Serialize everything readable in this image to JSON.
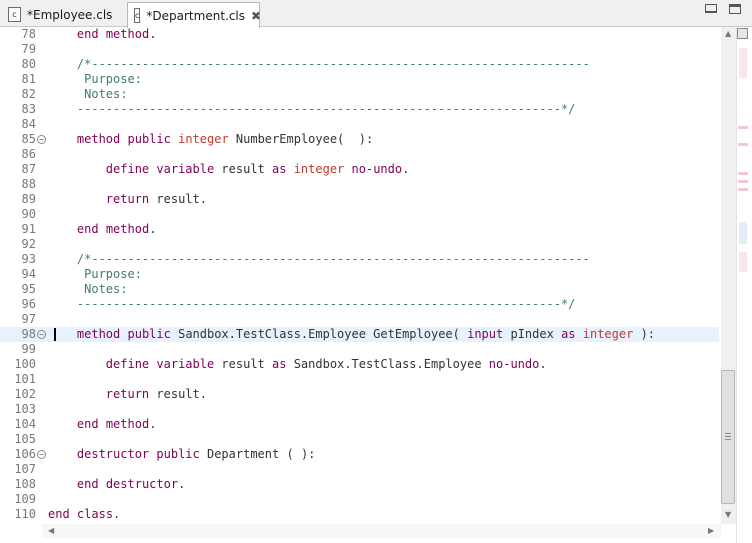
{
  "tabs": [
    {
      "label": "*Employee.cls",
      "icon": "file-icon",
      "icon_text": "c"
    },
    {
      "label": "*Department.cls",
      "icon": "file-icon",
      "icon_text": "c",
      "close": "✖"
    }
  ],
  "editor": {
    "current_line": 98,
    "lines": [
      {
        "n": "78",
        "t": "    end method."
      },
      {
        "n": "79",
        "t": ""
      },
      {
        "n": "80",
        "t": "    /*---------------------------------------------------------------------"
      },
      {
        "n": "81",
        "t": "     Purpose:"
      },
      {
        "n": "82",
        "t": "     Notes:"
      },
      {
        "n": "83",
        "t": "    -------------------------------------------------------------------*/"
      },
      {
        "n": "84",
        "t": ""
      },
      {
        "n": "85",
        "t": "    method public integer NumberEmployee(  ):",
        "fold": true
      },
      {
        "n": "86",
        "t": ""
      },
      {
        "n": "87",
        "t": "        define variable result as integer no-undo."
      },
      {
        "n": "88",
        "t": ""
      },
      {
        "n": "89",
        "t": "        return result."
      },
      {
        "n": "90",
        "t": ""
      },
      {
        "n": "91",
        "t": "    end method."
      },
      {
        "n": "92",
        "t": ""
      },
      {
        "n": "93",
        "t": "    /*---------------------------------------------------------------------"
      },
      {
        "n": "94",
        "t": "     Purpose:"
      },
      {
        "n": "95",
        "t": "     Notes:"
      },
      {
        "n": "96",
        "t": "    -------------------------------------------------------------------*/"
      },
      {
        "n": "97",
        "t": ""
      },
      {
        "n": "98",
        "t": "    method public Sandbox.TestClass.Employee GetEmployee( input pIndex as integer ):",
        "fold": true
      },
      {
        "n": "99",
        "t": ""
      },
      {
        "n": "100",
        "t": "        define variable result as Sandbox.TestClass.Employee no-undo."
      },
      {
        "n": "101",
        "t": ""
      },
      {
        "n": "102",
        "t": "        return result."
      },
      {
        "n": "103",
        "t": ""
      },
      {
        "n": "104",
        "t": "    end method."
      },
      {
        "n": "105",
        "t": ""
      },
      {
        "n": "106",
        "t": "    destructor public Department ( ):",
        "fold": true
      },
      {
        "n": "107",
        "t": ""
      },
      {
        "n": "108",
        "t": "    end destructor."
      },
      {
        "n": "109",
        "t": ""
      },
      {
        "n": "110",
        "t": "end class."
      }
    ]
  },
  "colors": {
    "keyword": "#7f0055",
    "type": "#c0392b",
    "comment": "#3f7f5f",
    "current_line": "#e8f2fe"
  }
}
